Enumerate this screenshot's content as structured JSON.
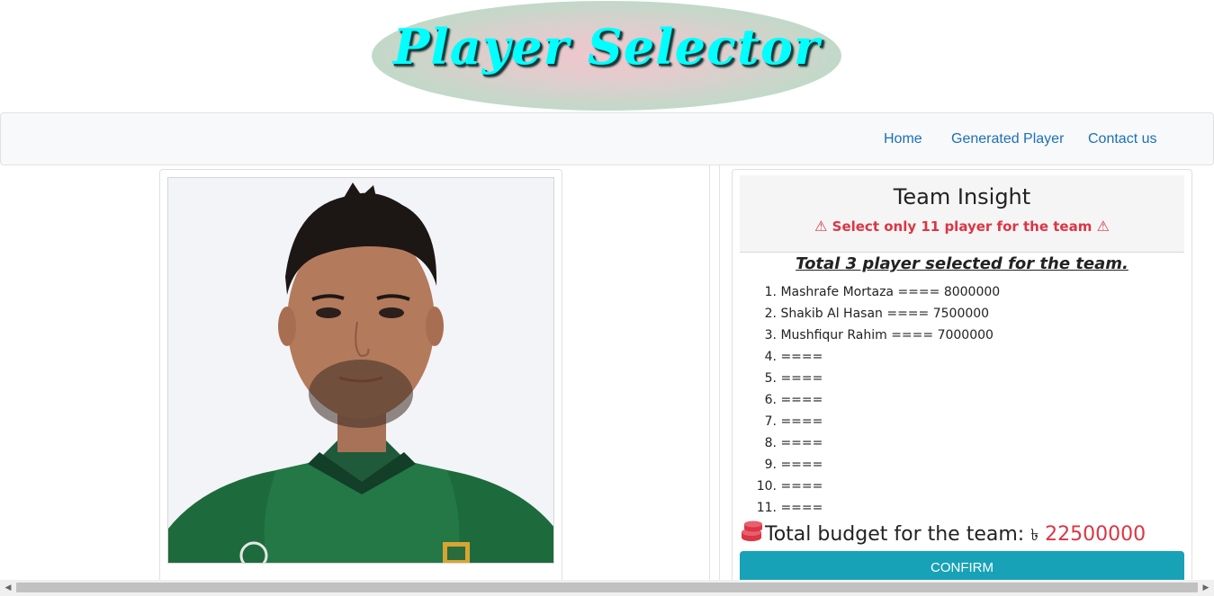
{
  "header": {
    "title": "Player Selector"
  },
  "nav": {
    "home": "Home",
    "generated": "Generated Player",
    "contact": "Contact us"
  },
  "player_card": {
    "photo_subject": "Mashrafe Mortaza"
  },
  "insight": {
    "title": "Team Insight",
    "warning": "Select only 11 player for the team",
    "total_selected": "Total 3 player selected for the team.",
    "players": [
      {
        "num": "1.",
        "text": "Mashrafe Mortaza ==== 8000000"
      },
      {
        "num": "2.",
        "text": "Shakib Al Hasan ==== 7500000"
      },
      {
        "num": "3.",
        "text": "Mushfiqur Rahim ==== 7000000"
      },
      {
        "num": "4.",
        "text": "===="
      },
      {
        "num": "5.",
        "text": "===="
      },
      {
        "num": "6.",
        "text": "===="
      },
      {
        "num": "7.",
        "text": "===="
      },
      {
        "num": "8.",
        "text": "===="
      },
      {
        "num": "9.",
        "text": "===="
      },
      {
        "num": "10.",
        "text": "===="
      },
      {
        "num": "11.",
        "text": "===="
      }
    ],
    "budget_label": "Total budget for the team: ",
    "currency": "৳",
    "budget_amount": "22500000",
    "confirm_label": "CONFIRM"
  },
  "colors": {
    "accent_red": "#dc3545",
    "confirm": "#17a2b8",
    "link": "#1c70b8",
    "title": "#00ffff"
  }
}
